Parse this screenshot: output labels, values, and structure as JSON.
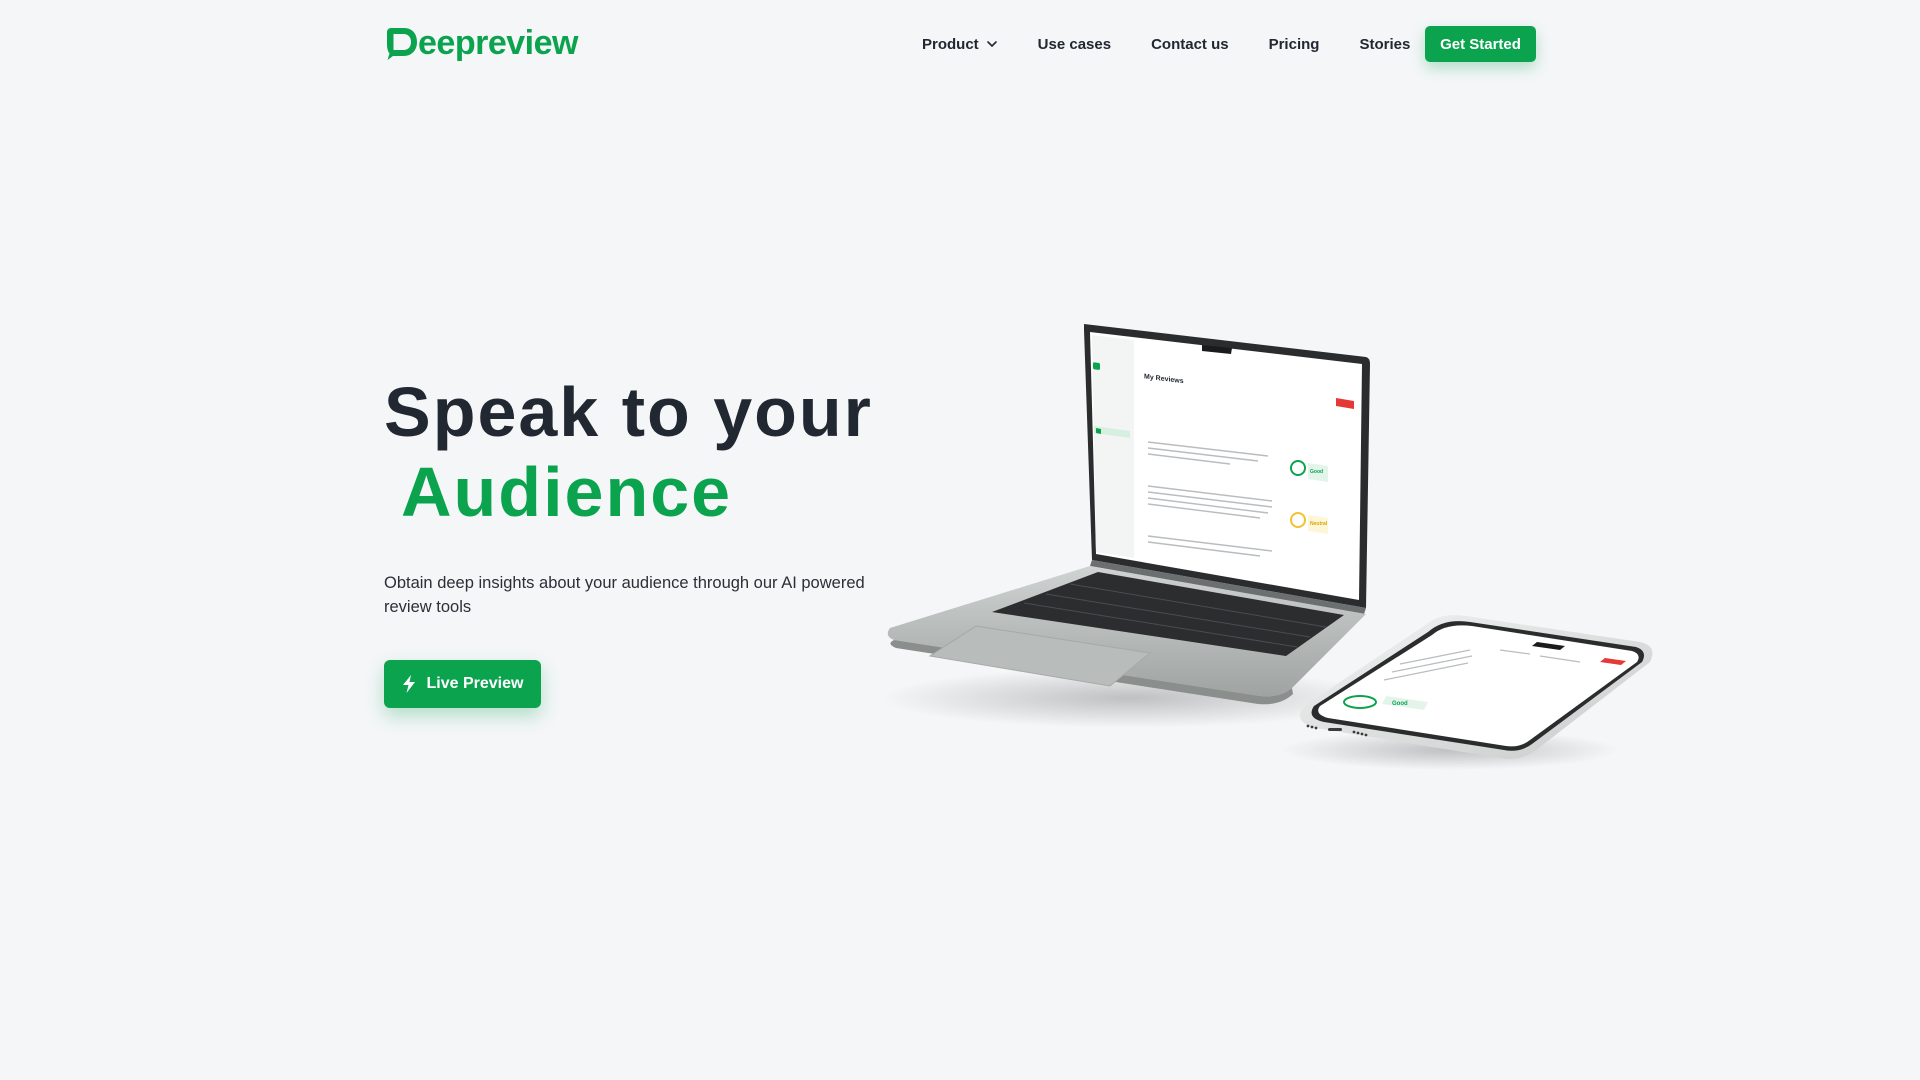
{
  "brand": {
    "name": "eepreview",
    "color": "#0ca34f"
  },
  "nav": {
    "items": [
      {
        "label": "Product",
        "has_dropdown": true
      },
      {
        "label": "Use cases"
      },
      {
        "label": "Contact us"
      },
      {
        "label": "Pricing"
      },
      {
        "label": "Stories"
      }
    ],
    "cta_label": "Get Started"
  },
  "hero": {
    "title_line1": "Speak to your",
    "title_line2": "Audience",
    "subtitle": "Obtain deep insights about your audience through our AI powered review tools",
    "button_label": "Live Preview",
    "button_icon": "lightning-bolt-icon"
  },
  "mockup": {
    "laptop_page_title": "My Reviews",
    "rating_good": "Good",
    "rating_neutral": "Neutral"
  },
  "colors": {
    "accent": "#0ca34f",
    "background": "#f4f6f8",
    "text": "#222831"
  }
}
